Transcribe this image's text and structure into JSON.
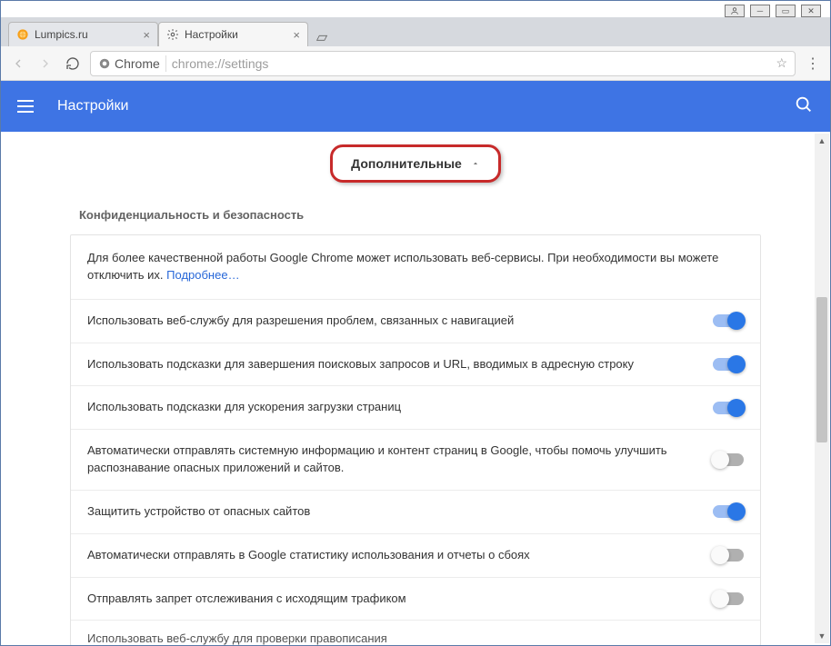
{
  "window": {
    "tabs": [
      {
        "label": "Lumpics.ru",
        "active": false,
        "favicon": "orange-slice-icon"
      },
      {
        "label": "Настройки",
        "active": true,
        "favicon": "gear-icon"
      }
    ]
  },
  "omnibox": {
    "origin_label": "Chrome",
    "path": "chrome://settings"
  },
  "header": {
    "title": "Настройки"
  },
  "advanced": {
    "label": "Дополнительные",
    "expanded": true
  },
  "section": {
    "title": "Конфиденциальность и безопасность",
    "intro_text": "Для более качественной работы Google Chrome может использовать веб-сервисы. При необходимости вы можете отключить их.",
    "intro_link": "Подробнее…",
    "items": [
      {
        "label": "Использовать веб-службу для разрешения проблем, связанных с навигацией",
        "on": true
      },
      {
        "label": "Использовать подсказки для завершения поисковых запросов и URL, вводимых в адресную строку",
        "on": true
      },
      {
        "label": "Использовать подсказки для ускорения загрузки страниц",
        "on": true
      },
      {
        "label": "Автоматически отправлять системную информацию и контент страниц в Google, чтобы помочь улучшить распознавание опасных приложений и сайтов.",
        "on": false
      },
      {
        "label": "Защитить устройство от опасных сайтов",
        "on": true
      },
      {
        "label": "Автоматически отправлять в Google статистику использования и отчеты о сбоях",
        "on": false
      },
      {
        "label": "Отправлять запрет отслеживания с исходящим трафиком",
        "on": false
      }
    ],
    "partial_next": "Использовать веб-службу для проверки правописания"
  }
}
